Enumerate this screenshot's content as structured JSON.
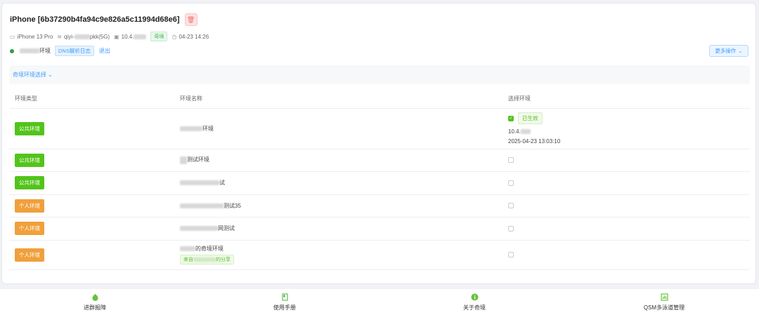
{
  "device": {
    "title": "iPhone [6b37290b4fa94c9e826a5c11994d68e6]",
    "model": "iPhone 13 Pro",
    "wifi_prefix": "qiyi-",
    "wifi_suffix": "pkk(5G)",
    "ip_prefix": "10.4.",
    "proxy_tag": "奇境",
    "time": "04-23 14:26"
  },
  "env_status": {
    "env_suffix": "环境",
    "dns_label": "DNS解析日志",
    "logout_label": "退出",
    "status_color": "#2ea043"
  },
  "toolbar": {
    "more_label": "更多操作"
  },
  "section": {
    "title": "奇境环境选择"
  },
  "table": {
    "headers": [
      "环境类型",
      "环境名称",
      "选择环境"
    ],
    "rows": [
      {
        "type": "公共环境",
        "kind": "public",
        "name_suffix": "环境",
        "selected": true,
        "active_label": "已生效",
        "ip": "10.4.",
        "updated": "2025-04-23 13:03:10"
      },
      {
        "type": "公共环境",
        "kind": "public",
        "name_suffix": "测试环境",
        "selected": false
      },
      {
        "type": "公共环境",
        "kind": "public",
        "name_suffix": "试",
        "selected": false
      },
      {
        "type": "个人环境",
        "kind": "personal",
        "name_suffix": "测试35",
        "selected": false
      },
      {
        "type": "个人环境",
        "kind": "personal",
        "name_suffix": "网测试",
        "selected": false
      },
      {
        "type": "个人环境",
        "kind": "personal",
        "name_suffix": "的奇境环境",
        "share_prefix": "来自",
        "share_suffix": "的分享",
        "selected": false
      }
    ]
  },
  "bottom_nav": [
    {
      "label": "进群报障",
      "icon": "feedback-icon"
    },
    {
      "label": "使用手册",
      "icon": "manual-icon"
    },
    {
      "label": "关于奇境",
      "icon": "info-icon"
    },
    {
      "label": "QSM多泳道管理",
      "icon": "chart-icon"
    }
  ],
  "colors": {
    "accent": "#409eff",
    "public": "#52c41a",
    "personal": "#f0a03c",
    "danger": "#f56c6c"
  }
}
